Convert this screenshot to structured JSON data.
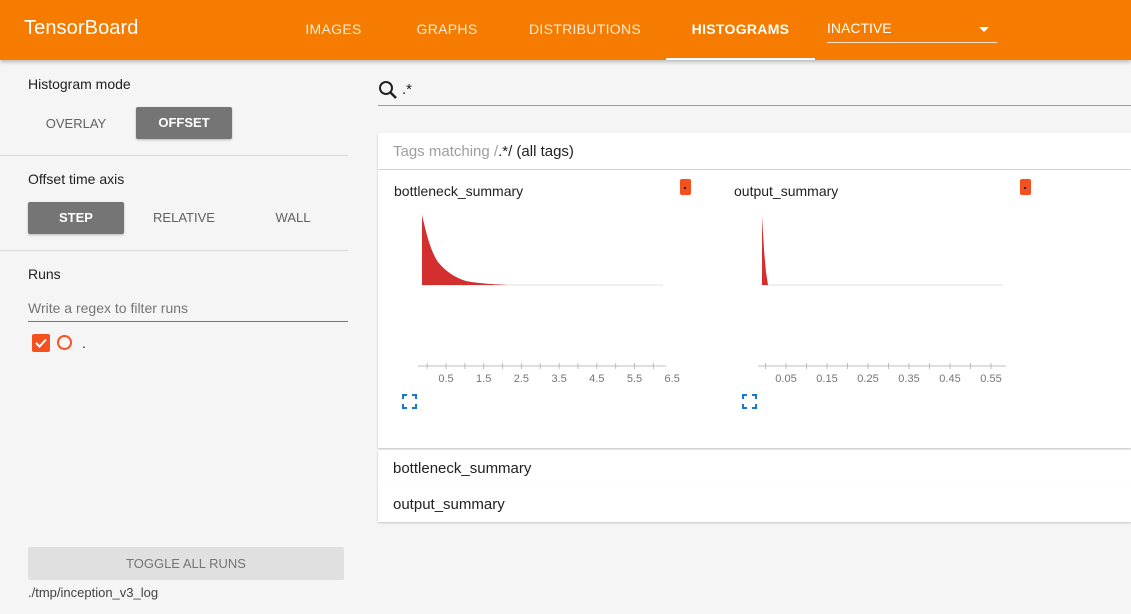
{
  "header": {
    "title": "TensorBoard",
    "tabs": [
      {
        "label": "IMAGES",
        "active": false
      },
      {
        "label": "GRAPHS",
        "active": false
      },
      {
        "label": "DISTRIBUTIONS",
        "active": false
      },
      {
        "label": "HISTOGRAMS",
        "active": true
      }
    ],
    "inactive_select": "INACTIVE"
  },
  "sidebar": {
    "histogram_mode": {
      "title": "Histogram mode",
      "options": [
        "OVERLAY",
        "OFFSET"
      ],
      "selected": "OFFSET"
    },
    "offset_axis": {
      "title": "Offset time axis",
      "options": [
        "STEP",
        "RELATIVE",
        "WALL"
      ],
      "selected": "STEP"
    },
    "runs": {
      "title": "Runs",
      "filter_placeholder": "Write a regex to filter runs",
      "items": [
        {
          "label": ".",
          "checked": true
        }
      ]
    },
    "toggle_all": "TOGGLE ALL RUNS",
    "logdir": "./tmp/inception_v3_log"
  },
  "main": {
    "search_value": ".*",
    "tags_header": {
      "prefix": "Tags matching /",
      "regex": ".*",
      "suffix": "/ (all tags)"
    },
    "charts": [
      {
        "title": "bottleneck_summary",
        "ticks": [
          "0.5",
          "1.5",
          "2.5",
          "3.5",
          "4.5",
          "5.5",
          "6.5"
        ]
      },
      {
        "title": "output_summary",
        "ticks": [
          "0.05",
          "0.15",
          "0.25",
          "0.35",
          "0.45",
          "0.55"
        ]
      }
    ],
    "collapsed": [
      "bottleneck_summary",
      "output_summary"
    ]
  },
  "colors": {
    "accent": "#f57c00",
    "run": "#f4511e",
    "hist_fill": "#d32f2f",
    "icon": "#1976d2"
  }
}
